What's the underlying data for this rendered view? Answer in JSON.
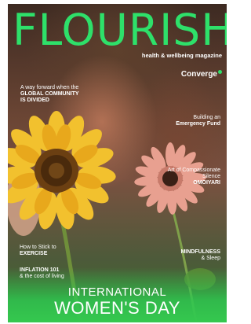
{
  "masthead": {
    "title": "FLOURISH",
    "subtitle": "health & wellbeing magazine"
  },
  "brand": {
    "name": "Converge"
  },
  "blurbs": [
    {
      "light": "A way forward when the",
      "strong": "GLOBAL COMMUNITY IS DIVIDED"
    },
    {
      "light": "Building an",
      "strong": "Emergency Fund"
    },
    {
      "light": "Art of Compassionate Silence",
      "strong": "OMOIYARI"
    },
    {
      "light": "How to Stick to",
      "strong": "EXERCISE"
    },
    {
      "strong": "INFLATION 101",
      "light": "& the cost of living"
    },
    {
      "strong": "MINDFULNESS",
      "light": "& Sleep"
    }
  ],
  "headline": {
    "line1": "INTERNATIONAL",
    "line2": "WOMEN'S DAY"
  },
  "colors": {
    "accent": "#2ee06a"
  }
}
